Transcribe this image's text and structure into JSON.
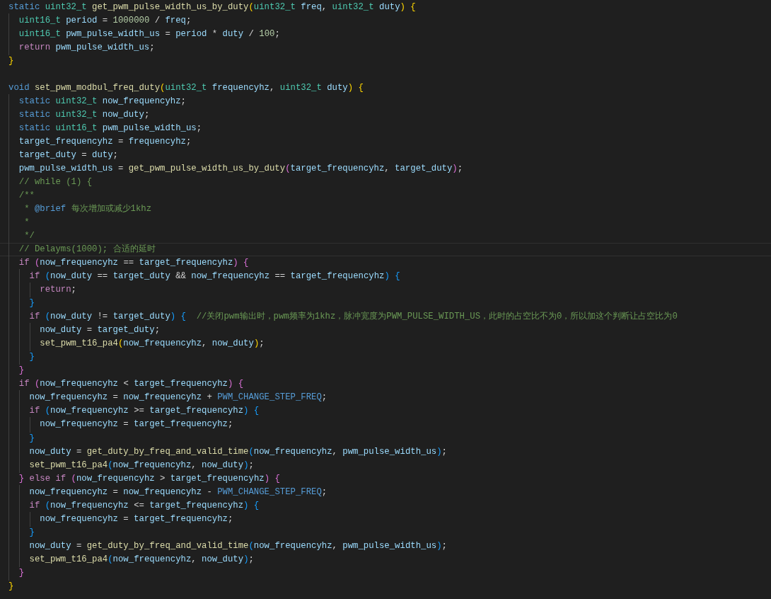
{
  "lines": [
    {
      "current": false,
      "tokens": [
        {
          "text": "static ",
          "kind": "keyword"
        },
        {
          "text": "uint32_t ",
          "kind": "type"
        },
        {
          "text": "get_pwm_pulse_width_us_by_duty",
          "kind": "func"
        },
        {
          "text": "(",
          "kind": "br1"
        },
        {
          "text": "uint32_t ",
          "kind": "type"
        },
        {
          "text": "freq",
          "kind": "var"
        },
        {
          "text": ", ",
          "kind": "plain"
        },
        {
          "text": "uint32_t ",
          "kind": "type"
        },
        {
          "text": "duty",
          "kind": "var"
        },
        {
          "text": ") {",
          "kind": "br1"
        }
      ]
    },
    {
      "current": false,
      "tokens": [
        {
          "text": "  uint16_t ",
          "kind": "type"
        },
        {
          "text": "period",
          "kind": "var"
        },
        {
          "text": " = ",
          "kind": "plain"
        },
        {
          "text": "1000000",
          "kind": "num"
        },
        {
          "text": " / ",
          "kind": "plain"
        },
        {
          "text": "freq",
          "kind": "var"
        },
        {
          "text": ";",
          "kind": "plain"
        }
      ]
    },
    {
      "current": false,
      "tokens": [
        {
          "text": "  uint16_t ",
          "kind": "type"
        },
        {
          "text": "pwm_pulse_width_us",
          "kind": "var"
        },
        {
          "text": " = ",
          "kind": "plain"
        },
        {
          "text": "period",
          "kind": "var"
        },
        {
          "text": " * ",
          "kind": "plain"
        },
        {
          "text": "duty",
          "kind": "var"
        },
        {
          "text": " / ",
          "kind": "plain"
        },
        {
          "text": "100",
          "kind": "num"
        },
        {
          "text": ";",
          "kind": "plain"
        }
      ]
    },
    {
      "current": false,
      "tokens": [
        {
          "text": "  return ",
          "kind": "ctrl"
        },
        {
          "text": "pwm_pulse_width_us",
          "kind": "var"
        },
        {
          "text": ";",
          "kind": "plain"
        }
      ]
    },
    {
      "current": false,
      "tokens": [
        {
          "text": "}",
          "kind": "br1"
        }
      ]
    },
    {
      "current": false
    },
    {
      "current": false,
      "tokens": [
        {
          "text": "void ",
          "kind": "keyword"
        },
        {
          "text": "set_pwm_modbul_freq_duty",
          "kind": "func"
        },
        {
          "text": "(",
          "kind": "br1"
        },
        {
          "text": "uint32_t ",
          "kind": "type"
        },
        {
          "text": "frequencyhz",
          "kind": "var"
        },
        {
          "text": ", ",
          "kind": "plain"
        },
        {
          "text": "uint32_t ",
          "kind": "type"
        },
        {
          "text": "duty",
          "kind": "var"
        },
        {
          "text": ") {",
          "kind": "br1"
        }
      ]
    },
    {
      "current": false,
      "tokens": [
        {
          "text": "  static ",
          "kind": "keyword"
        },
        {
          "text": "uint32_t ",
          "kind": "type"
        },
        {
          "text": "now_frequencyhz",
          "kind": "var"
        },
        {
          "text": ";",
          "kind": "plain"
        }
      ]
    },
    {
      "current": false,
      "tokens": [
        {
          "text": "  static ",
          "kind": "keyword"
        },
        {
          "text": "uint32_t ",
          "kind": "type"
        },
        {
          "text": "now_duty",
          "kind": "var"
        },
        {
          "text": ";",
          "kind": "plain"
        }
      ]
    },
    {
      "current": false,
      "tokens": [
        {
          "text": "  static ",
          "kind": "keyword"
        },
        {
          "text": "uint16_t ",
          "kind": "type"
        },
        {
          "text": "pwm_pulse_width_us",
          "kind": "var"
        },
        {
          "text": ";",
          "kind": "plain"
        }
      ]
    },
    {
      "current": false,
      "tokens": [
        {
          "text": "  target_frequencyhz",
          "kind": "var"
        },
        {
          "text": " = ",
          "kind": "plain"
        },
        {
          "text": "frequencyhz",
          "kind": "var"
        },
        {
          "text": ";",
          "kind": "plain"
        }
      ]
    },
    {
      "current": false,
      "tokens": [
        {
          "text": "  target_duty",
          "kind": "var"
        },
        {
          "text": " = ",
          "kind": "plain"
        },
        {
          "text": "duty",
          "kind": "var"
        },
        {
          "text": ";",
          "kind": "plain"
        }
      ]
    },
    {
      "current": false,
      "tokens": [
        {
          "text": "  pwm_pulse_width_us",
          "kind": "var"
        },
        {
          "text": " = ",
          "kind": "plain"
        },
        {
          "text": "get_pwm_pulse_width_us_by_duty",
          "kind": "func"
        },
        {
          "text": "(",
          "kind": "br2"
        },
        {
          "text": "target_frequencyhz",
          "kind": "var"
        },
        {
          "text": ", ",
          "kind": "plain"
        },
        {
          "text": "target_duty",
          "kind": "var"
        },
        {
          "text": ")",
          "kind": "br2"
        },
        {
          "text": ";",
          "kind": "plain"
        }
      ]
    },
    {
      "current": false,
      "tokens": [
        {
          "text": "  // while (1) {",
          "kind": "comment"
        }
      ]
    },
    {
      "current": false,
      "tokens": [
        {
          "text": "  /**",
          "kind": "comment"
        }
      ]
    },
    {
      "current": false,
      "tokens": [
        {
          "text": "   * ",
          "kind": "comment"
        },
        {
          "text": "@brief",
          "kind": "keyword"
        },
        {
          "text": " 每次增加或减少1khz",
          "kind": "comment"
        }
      ]
    },
    {
      "current": false,
      "tokens": [
        {
          "text": "   *",
          "kind": "comment"
        }
      ]
    },
    {
      "current": false,
      "tokens": [
        {
          "text": "   */",
          "kind": "comment"
        }
      ]
    },
    {
      "current": true,
      "tokens": [
        {
          "text": "  // Delayms(1000); 合适的延时",
          "kind": "comment"
        }
      ]
    },
    {
      "current": false,
      "tokens": [
        {
          "text": "  if ",
          "kind": "ctrl"
        },
        {
          "text": "(",
          "kind": "br2"
        },
        {
          "text": "now_frequencyhz",
          "kind": "var"
        },
        {
          "text": " == ",
          "kind": "plain"
        },
        {
          "text": "target_frequencyhz",
          "kind": "var"
        },
        {
          "text": ") {",
          "kind": "br2"
        }
      ]
    },
    {
      "current": false,
      "tokens": [
        {
          "text": "    if ",
          "kind": "ctrl"
        },
        {
          "text": "(",
          "kind": "br3"
        },
        {
          "text": "now_duty",
          "kind": "var"
        },
        {
          "text": " == ",
          "kind": "plain"
        },
        {
          "text": "target_duty",
          "kind": "var"
        },
        {
          "text": " && ",
          "kind": "plain"
        },
        {
          "text": "now_frequencyhz",
          "kind": "var"
        },
        {
          "text": " == ",
          "kind": "plain"
        },
        {
          "text": "target_frequencyhz",
          "kind": "var"
        },
        {
          "text": ") {",
          "kind": "br3"
        }
      ]
    },
    {
      "current": false,
      "tokens": [
        {
          "text": "      return",
          "kind": "ctrl"
        },
        {
          "text": ";",
          "kind": "plain"
        }
      ]
    },
    {
      "current": false,
      "tokens": [
        {
          "text": "    }",
          "kind": "br3"
        }
      ]
    },
    {
      "current": false,
      "tokens": [
        {
          "text": "    if ",
          "kind": "ctrl"
        },
        {
          "text": "(",
          "kind": "br3"
        },
        {
          "text": "now_duty",
          "kind": "var"
        },
        {
          "text": " != ",
          "kind": "plain"
        },
        {
          "text": "target_duty",
          "kind": "var"
        },
        {
          "text": ") {",
          "kind": "br3"
        },
        {
          "text": "  //关闭pwm输出时，pwm频率为1khz，脉冲宽度为PWM_PULSE_WIDTH_US，此时的占空比不为0，所以加这个判断让占空比为0",
          "kind": "comment"
        }
      ]
    },
    {
      "current": false,
      "tokens": [
        {
          "text": "      now_duty",
          "kind": "var"
        },
        {
          "text": " = ",
          "kind": "plain"
        },
        {
          "text": "target_duty",
          "kind": "var"
        },
        {
          "text": ";",
          "kind": "plain"
        }
      ]
    },
    {
      "current": false,
      "tokens": [
        {
          "text": "      set_pwm_t16_pa4",
          "kind": "func"
        },
        {
          "text": "(",
          "kind": "br1"
        },
        {
          "text": "now_frequencyhz",
          "kind": "var"
        },
        {
          "text": ", ",
          "kind": "plain"
        },
        {
          "text": "now_duty",
          "kind": "var"
        },
        {
          "text": ")",
          "kind": "br1"
        },
        {
          "text": ";",
          "kind": "plain"
        }
      ]
    },
    {
      "current": false,
      "tokens": [
        {
          "text": "    }",
          "kind": "br3"
        }
      ]
    },
    {
      "current": false,
      "tokens": [
        {
          "text": "  }",
          "kind": "br2"
        }
      ]
    },
    {
      "current": false,
      "tokens": [
        {
          "text": "  if ",
          "kind": "ctrl"
        },
        {
          "text": "(",
          "kind": "br2"
        },
        {
          "text": "now_frequencyhz",
          "kind": "var"
        },
        {
          "text": " < ",
          "kind": "plain"
        },
        {
          "text": "target_frequencyhz",
          "kind": "var"
        },
        {
          "text": ") {",
          "kind": "br2"
        }
      ]
    },
    {
      "current": false,
      "tokens": [
        {
          "text": "    now_frequencyhz",
          "kind": "var"
        },
        {
          "text": " = ",
          "kind": "plain"
        },
        {
          "text": "now_frequencyhz",
          "kind": "var"
        },
        {
          "text": " + ",
          "kind": "plain"
        },
        {
          "text": "PWM_CHANGE_STEP_FREQ",
          "kind": "keyword"
        },
        {
          "text": ";",
          "kind": "plain"
        }
      ]
    },
    {
      "current": false,
      "tokens": [
        {
          "text": "    if ",
          "kind": "ctrl"
        },
        {
          "text": "(",
          "kind": "br3"
        },
        {
          "text": "now_frequencyhz",
          "kind": "var"
        },
        {
          "text": " >= ",
          "kind": "plain"
        },
        {
          "text": "target_frequencyhz",
          "kind": "var"
        },
        {
          "text": ") {",
          "kind": "br3"
        }
      ]
    },
    {
      "current": false,
      "tokens": [
        {
          "text": "      now_frequencyhz",
          "kind": "var"
        },
        {
          "text": " = ",
          "kind": "plain"
        },
        {
          "text": "target_frequencyhz",
          "kind": "var"
        },
        {
          "text": ";",
          "kind": "plain"
        }
      ]
    },
    {
      "current": false,
      "tokens": [
        {
          "text": "    }",
          "kind": "br3"
        }
      ]
    },
    {
      "current": false,
      "tokens": [
        {
          "text": "    now_duty",
          "kind": "var"
        },
        {
          "text": " = ",
          "kind": "plain"
        },
        {
          "text": "get_duty_by_freq_and_valid_time",
          "kind": "func"
        },
        {
          "text": "(",
          "kind": "br3"
        },
        {
          "text": "now_frequencyhz",
          "kind": "var"
        },
        {
          "text": ", ",
          "kind": "plain"
        },
        {
          "text": "pwm_pulse_width_us",
          "kind": "var"
        },
        {
          "text": ")",
          "kind": "br3"
        },
        {
          "text": ";",
          "kind": "plain"
        }
      ]
    },
    {
      "current": false,
      "tokens": [
        {
          "text": "    set_pwm_t16_pa4",
          "kind": "func"
        },
        {
          "text": "(",
          "kind": "br3"
        },
        {
          "text": "now_frequencyhz",
          "kind": "var"
        },
        {
          "text": ", ",
          "kind": "plain"
        },
        {
          "text": "now_duty",
          "kind": "var"
        },
        {
          "text": ")",
          "kind": "br3"
        },
        {
          "text": ";",
          "kind": "plain"
        }
      ]
    },
    {
      "current": false,
      "tokens": [
        {
          "text": "  } ",
          "kind": "br2"
        },
        {
          "text": "else if ",
          "kind": "ctrl"
        },
        {
          "text": "(",
          "kind": "br2"
        },
        {
          "text": "now_frequencyhz",
          "kind": "var"
        },
        {
          "text": " > ",
          "kind": "plain"
        },
        {
          "text": "target_frequencyhz",
          "kind": "var"
        },
        {
          "text": ") {",
          "kind": "br2"
        }
      ]
    },
    {
      "current": false,
      "tokens": [
        {
          "text": "    now_frequencyhz",
          "kind": "var"
        },
        {
          "text": " = ",
          "kind": "plain"
        },
        {
          "text": "now_frequencyhz",
          "kind": "var"
        },
        {
          "text": " - ",
          "kind": "plain"
        },
        {
          "text": "PWM_CHANGE_STEP_FREQ",
          "kind": "keyword"
        },
        {
          "text": ";",
          "kind": "plain"
        }
      ]
    },
    {
      "current": false,
      "tokens": [
        {
          "text": "    if ",
          "kind": "ctrl"
        },
        {
          "text": "(",
          "kind": "br3"
        },
        {
          "text": "now_frequencyhz",
          "kind": "var"
        },
        {
          "text": " <= ",
          "kind": "plain"
        },
        {
          "text": "target_frequencyhz",
          "kind": "var"
        },
        {
          "text": ") {",
          "kind": "br3"
        }
      ]
    },
    {
      "current": false,
      "tokens": [
        {
          "text": "      now_frequencyhz",
          "kind": "var"
        },
        {
          "text": " = ",
          "kind": "plain"
        },
        {
          "text": "target_frequencyhz",
          "kind": "var"
        },
        {
          "text": ";",
          "kind": "plain"
        }
      ]
    },
    {
      "current": false,
      "tokens": [
        {
          "text": "    }",
          "kind": "br3"
        }
      ]
    },
    {
      "current": false,
      "tokens": [
        {
          "text": "    now_duty",
          "kind": "var"
        },
        {
          "text": " = ",
          "kind": "plain"
        },
        {
          "text": "get_duty_by_freq_and_valid_time",
          "kind": "func"
        },
        {
          "text": "(",
          "kind": "br3"
        },
        {
          "text": "now_frequencyhz",
          "kind": "var"
        },
        {
          "text": ", ",
          "kind": "plain"
        },
        {
          "text": "pwm_pulse_width_us",
          "kind": "var"
        },
        {
          "text": ")",
          "kind": "br3"
        },
        {
          "text": ";",
          "kind": "plain"
        }
      ]
    },
    {
      "current": false,
      "tokens": [
        {
          "text": "    set_pwm_t16_pa4",
          "kind": "func"
        },
        {
          "text": "(",
          "kind": "br3"
        },
        {
          "text": "now_frequencyhz",
          "kind": "var"
        },
        {
          "text": ", ",
          "kind": "plain"
        },
        {
          "text": "now_duty",
          "kind": "var"
        },
        {
          "text": ")",
          "kind": "br3"
        },
        {
          "text": ";",
          "kind": "plain"
        }
      ]
    },
    {
      "current": false,
      "tokens": [
        {
          "text": "  }",
          "kind": "br2"
        }
      ]
    },
    {
      "current": false,
      "tokens": [
        {
          "text": "}",
          "kind": "br1"
        }
      ]
    }
  ]
}
